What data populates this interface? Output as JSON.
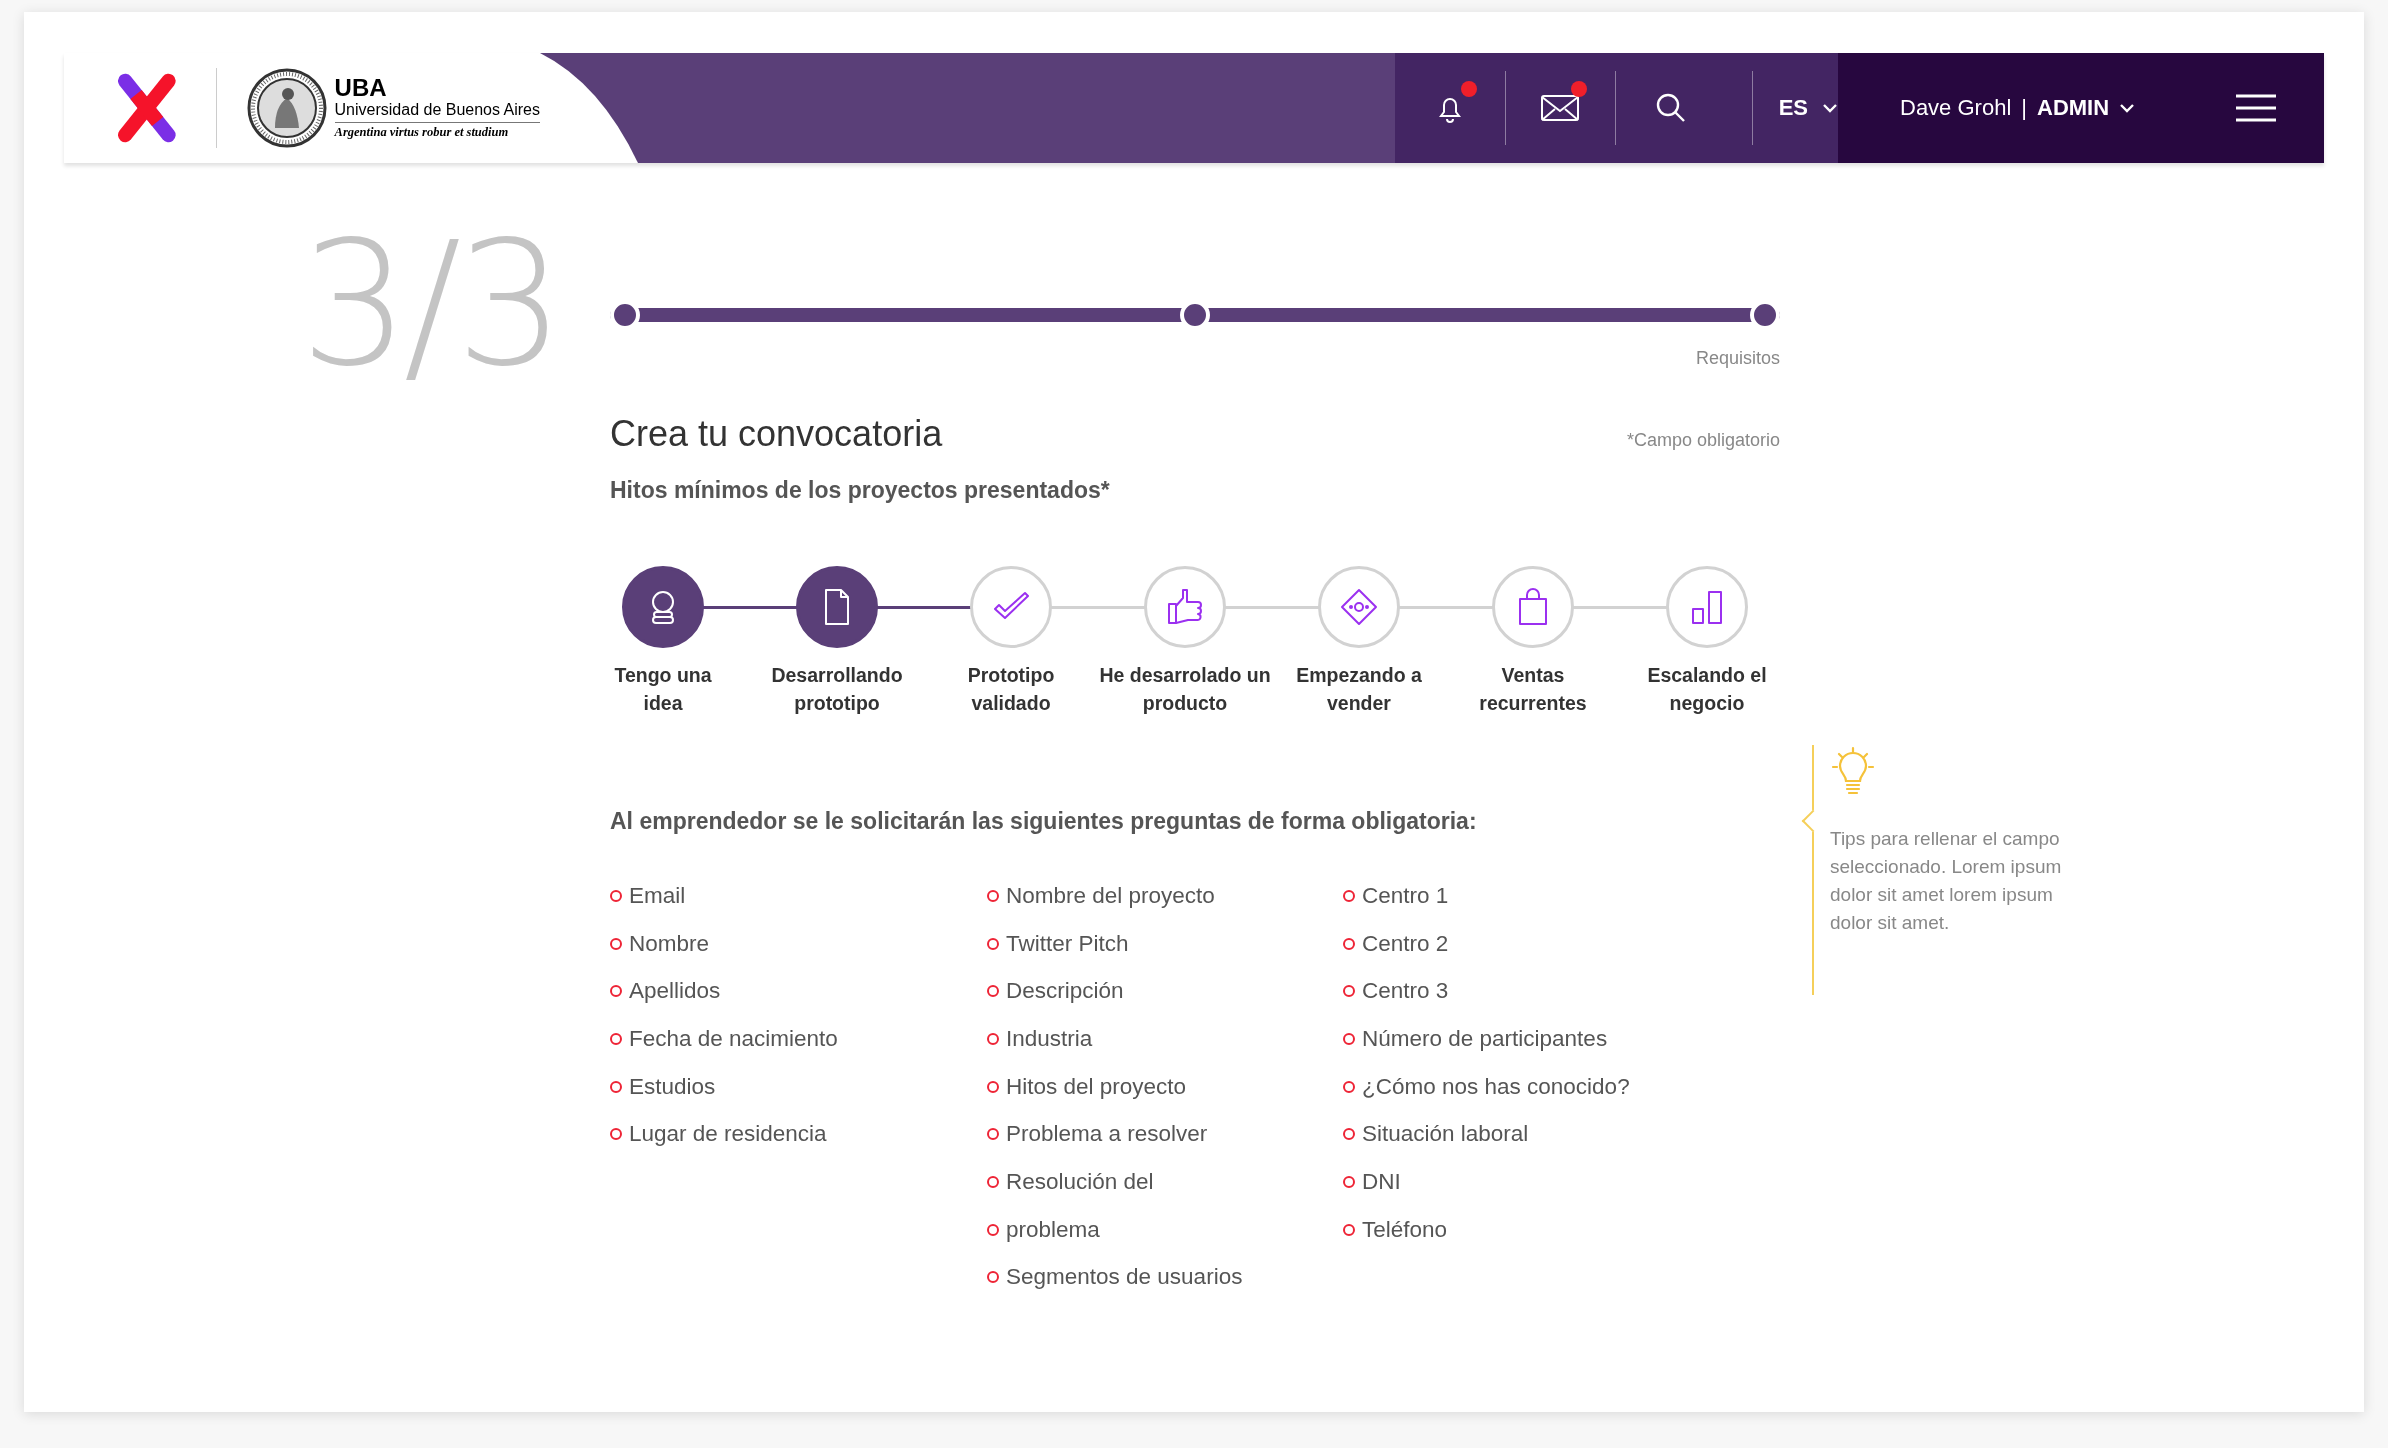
{
  "header": {
    "logo": {
      "acronym": "UBA",
      "name": "Universidad de Buenos Aires",
      "motto": "Argentina virtus robur et studium"
    },
    "icons": [
      {
        "kind": "bell",
        "badge": true
      },
      {
        "kind": "mail",
        "badge": true
      },
      {
        "kind": "search",
        "badge": false
      }
    ],
    "language": "ES",
    "user": {
      "name": "Dave Grohl",
      "separator": "|",
      "role": "ADMIN"
    }
  },
  "step_counter": "3/3",
  "progress": {
    "level": 1,
    "label": "Requisitos"
  },
  "title": "Crea tu convocatoria",
  "required_note": "*Campo obligatorio",
  "milestones_label": "Hitos mínimos de los proyectos presentados*",
  "milestones": [
    {
      "kind": "idea",
      "label": "Tengo una\nidea",
      "completed": true
    },
    {
      "kind": "document",
      "label": "Desarrollando\nprototipo",
      "completed": true
    },
    {
      "kind": "check",
      "label": "Prototipo\nvalidado",
      "completed": false
    },
    {
      "kind": "thumb",
      "label": "He desarrolado un\nproducto",
      "completed": false
    },
    {
      "kind": "money",
      "label": "Empezando a\nvender",
      "completed": false
    },
    {
      "kind": "bag",
      "label": "Ventas\nrecurrentes",
      "completed": false
    },
    {
      "kind": "chart",
      "label": "Escalando el\nnegocio",
      "completed": false
    }
  ],
  "questions_heading": "Al emprendedor se le solicitarán las siguientes preguntas de forma obligatoria:",
  "question_columns": [
    [
      "Email",
      "Nombre",
      "Apellidos",
      "Fecha de nacimiento",
      "Estudios",
      "Lugar de residencia"
    ],
    [
      "Nombre del proyecto",
      "Twitter Pitch",
      "Descripción",
      "Industria",
      "Hitos del proyecto",
      "Problema a resolver",
      "Resolución del",
      "problema",
      "Segmentos de usuarios"
    ],
    [
      "Centro 1",
      "Centro 2",
      "Centro 3",
      "Número de participantes",
      "¿Cómo nos has conocido?",
      "Situación laboral",
      "DNI",
      "Teléfono"
    ]
  ],
  "tip": "Tips para rellenar el campo seleccionado. Lorem ipsum dolor sit amet lorem ipsum dolor sit amet."
}
